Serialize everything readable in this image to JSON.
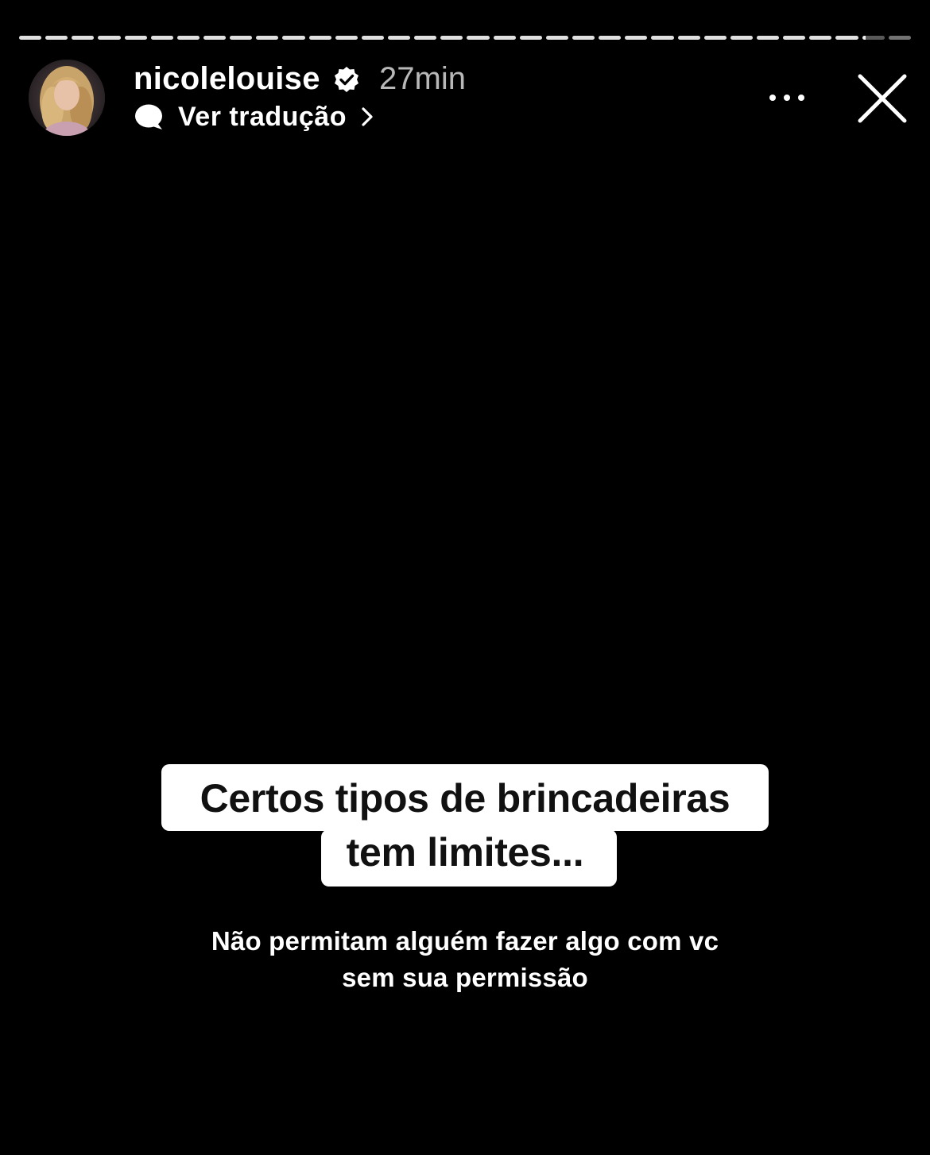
{
  "story": {
    "progress_segments_total": 34,
    "progress_segments_completed": 32,
    "current_segment_progress": 0.15
  },
  "header": {
    "username": "nicolelouise",
    "verified": true,
    "time_ago": "27min",
    "translate_label": "Ver tradução"
  },
  "icons": {
    "verified": "verified-badge-icon",
    "speech_bubble": "speech-bubble-icon",
    "chevron": "chevron-right-icon",
    "more": "more-dots-icon",
    "close": "close-icon"
  },
  "content": {
    "caption_line1": "Certos tipos de brincadeiras",
    "caption_line2": "tem limites...",
    "sub_line1": "Não permitam alguém fazer algo com vc",
    "sub_line2": "sem sua permissão"
  },
  "colors": {
    "background": "#000000",
    "text": "#ffffff",
    "caption_bg": "#ffffff"
  }
}
